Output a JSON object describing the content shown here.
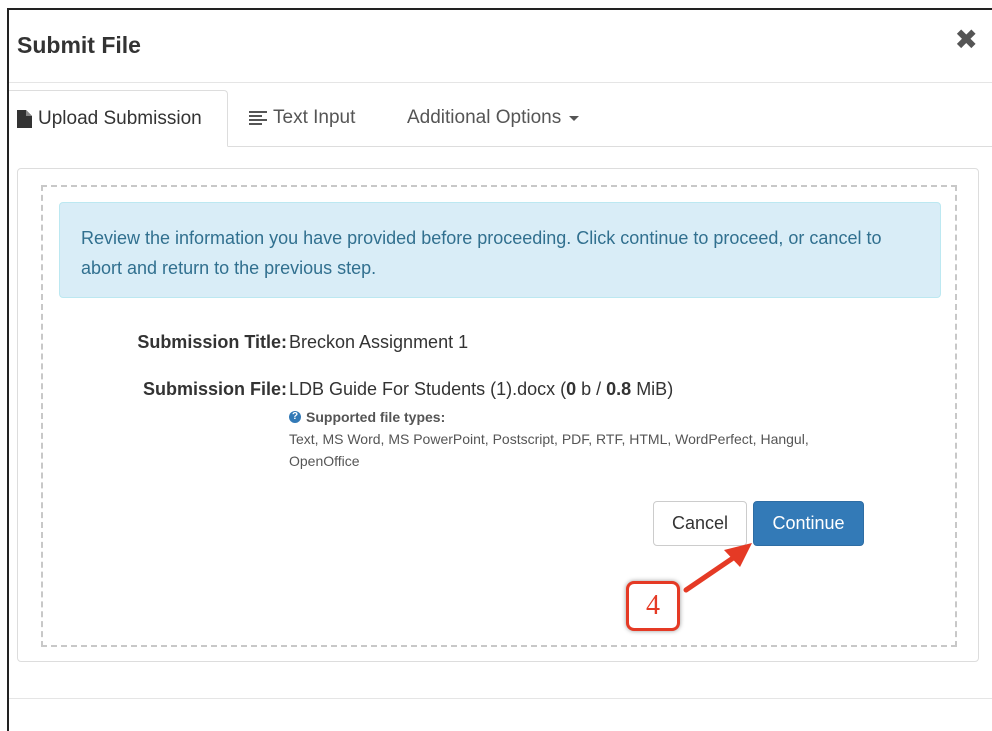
{
  "modal": {
    "title": "Submit File",
    "close_icon": "close-icon"
  },
  "tabs": [
    {
      "label": "Upload Submission",
      "icon": "file-icon",
      "active": true
    },
    {
      "label": "Text Input",
      "icon": "align-left-icon",
      "active": false
    },
    {
      "label": "Additional Options",
      "icon": "caret-down-icon",
      "active": false
    }
  ],
  "info": {
    "message": "Review the information you have provided before proceeding. Click continue to proceed, or cancel to abort and return to the previous step."
  },
  "submission": {
    "title_label": "Submission Title:",
    "title_value": "Breckon Assignment 1",
    "file_label": "Submission File:",
    "file_name": "LDB Guide For Students (1).docx (",
    "file_size_used": "0",
    "file_size_sep": " b / ",
    "file_size_max": "0.8",
    "file_size_unit": " MiB)"
  },
  "help": {
    "heading": "Supported file types:",
    "types": "Text, MS Word, MS PowerPoint, Postscript, PDF, RTF, HTML, WordPerfect, Hangul, OpenOffice"
  },
  "buttons": {
    "cancel": "Cancel",
    "continue": "Continue"
  },
  "annotation": {
    "step": "4",
    "color": "#e53a25"
  },
  "colors": {
    "primary": "#337ab7",
    "info_bg": "#d9edf7",
    "info_text": "#31708f"
  }
}
